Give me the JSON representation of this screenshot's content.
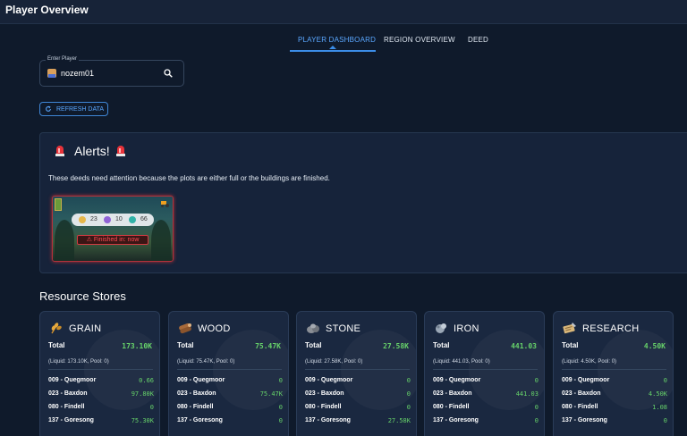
{
  "app": {
    "title": "Player Overview"
  },
  "tabs": [
    {
      "label": "PLAYER DASHBOARD",
      "active": true
    },
    {
      "label": "REGION OVERVIEW",
      "active": false
    },
    {
      "label": "DEED",
      "active": false
    }
  ],
  "player": {
    "legend": "Enter Player",
    "value": "nozem01",
    "search_icon": "search-icon"
  },
  "refresh": {
    "label": "REFRESH DATA",
    "icon": "refresh-icon"
  },
  "alerts": {
    "title": "Alerts!",
    "icon": "siren-icon",
    "message": "These deeds need attention because the plots are either full or the buildings are finished.",
    "deed": {
      "counts": [
        "23",
        "10",
        "66"
      ],
      "status": "Finished in: now"
    }
  },
  "resource_section": {
    "title": "Resource Stores"
  },
  "resources": [
    {
      "name": "GRAIN",
      "total_label": "Total",
      "total": "173.10K",
      "liquid": "(Liquid: 173.10K, Pool: 0)",
      "rows": [
        {
          "label": "009 - Quegmoor",
          "value": "0.66"
        },
        {
          "label": "023 - Baxdon",
          "value": "97.80K"
        },
        {
          "label": "080 - Findell",
          "value": "0"
        },
        {
          "label": "137 - Goresong",
          "value": "75.30K"
        }
      ]
    },
    {
      "name": "WOOD",
      "total_label": "Total",
      "total": "75.47K",
      "liquid": "(Liquid: 75.47K, Pool: 0)",
      "rows": [
        {
          "label": "009 - Quegmoor",
          "value": "0"
        },
        {
          "label": "023 - Baxdon",
          "value": "75.47K"
        },
        {
          "label": "080 - Findell",
          "value": "0"
        },
        {
          "label": "137 - Goresong",
          "value": "0"
        }
      ]
    },
    {
      "name": "STONE",
      "total_label": "Total",
      "total": "27.58K",
      "liquid": "(Liquid: 27.58K, Pool: 0)",
      "rows": [
        {
          "label": "009 - Quegmoor",
          "value": "0"
        },
        {
          "label": "023 - Baxdon",
          "value": "0"
        },
        {
          "label": "080 - Findell",
          "value": "0"
        },
        {
          "label": "137 - Goresong",
          "value": "27.58K"
        }
      ]
    },
    {
      "name": "IRON",
      "total_label": "Total",
      "total": "441.03",
      "liquid": "(Liquid: 441.03, Pool: 0)",
      "rows": [
        {
          "label": "009 - Quegmoor",
          "value": "0"
        },
        {
          "label": "023 - Baxdon",
          "value": "441.03"
        },
        {
          "label": "080 - Findell",
          "value": "0"
        },
        {
          "label": "137 - Goresong",
          "value": "0"
        }
      ]
    },
    {
      "name": "RESEARCH",
      "total_label": "Total",
      "total": "4.50K",
      "liquid": "(Liquid: 4.50K, Pool: 0)",
      "rows": [
        {
          "label": "009 - Quegmoor",
          "value": "0"
        },
        {
          "label": "023 - Baxdon",
          "value": "4.50K"
        },
        {
          "label": "080 - Findell",
          "value": "1.08"
        },
        {
          "label": "137 - Goresong",
          "value": "0"
        }
      ]
    }
  ],
  "colors": {
    "accent": "#3b8de8",
    "value_green": "#67d36a",
    "alert_red": "#d23b43",
    "background": "#0f1a2b"
  }
}
